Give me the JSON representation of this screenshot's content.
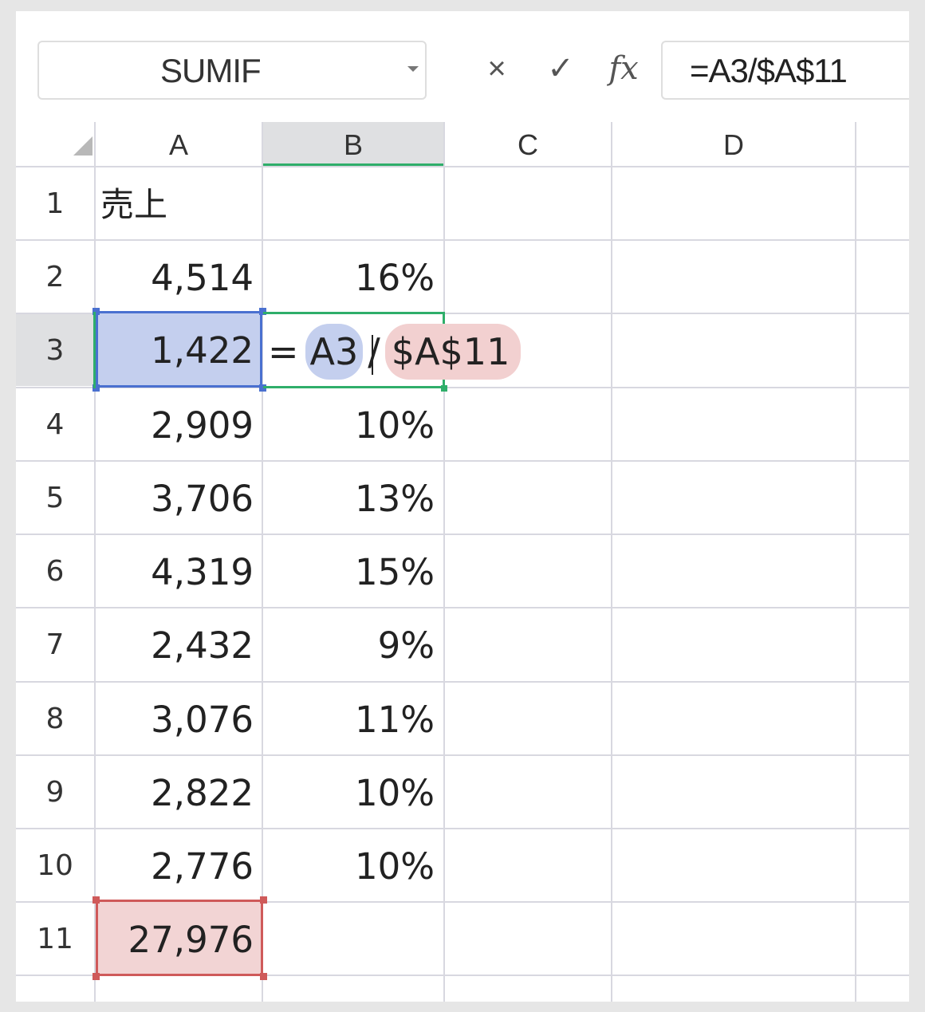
{
  "formula_bar": {
    "name_box": "SUMIF",
    "cancel_glyph": "×",
    "enter_glyph": "✓",
    "fx_label": "fx",
    "formula_text": "=A3/$A$11"
  },
  "columns": [
    "A",
    "B",
    "C",
    "D"
  ],
  "selected_column": "B",
  "rows": [
    {
      "row": "1",
      "a": "売上",
      "b": ""
    },
    {
      "row": "2",
      "a": "4,514",
      "b": "16%"
    },
    {
      "row": "3",
      "a": "1,422",
      "b": ""
    },
    {
      "row": "4",
      "a": "2,909",
      "b": "10%"
    },
    {
      "row": "5",
      "a": "3,706",
      "b": "13%"
    },
    {
      "row": "6",
      "a": "4,319",
      "b": "15%"
    },
    {
      "row": "7",
      "a": "2,432",
      "b": "9%"
    },
    {
      "row": "8",
      "a": "3,076",
      "b": "11%"
    },
    {
      "row": "9",
      "a": "2,822",
      "b": "10%"
    },
    {
      "row": "10",
      "a": "2,776",
      "b": "10%"
    },
    {
      "row": "11",
      "a": "27,976",
      "b": ""
    }
  ],
  "editing_cell": {
    "ref": "B3",
    "tokens": {
      "eq": "=",
      "ref1_a": "A",
      "ref1_b": "3",
      "slash": "/",
      "ref2": "$A$11"
    }
  },
  "colors": {
    "ref1_fill": "#c4cfee",
    "ref1_border": "#4a70d0",
    "ref2_fill": "#f2d4d4",
    "ref2_border": "#cf5a5a",
    "active_border": "#2fae6a"
  }
}
